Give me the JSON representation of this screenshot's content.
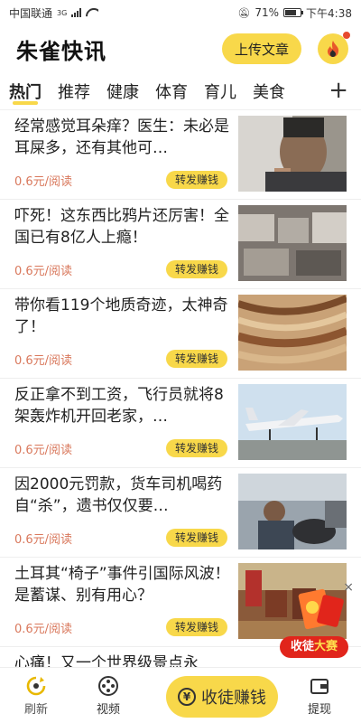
{
  "status_bar": {
    "carrier": "中国联通",
    "network": "3G",
    "battery": "71%",
    "time": "下午4:38"
  },
  "header": {
    "title": "朱雀快讯",
    "upload_label": "上传文章",
    "fire_icon": "fire-icon"
  },
  "tabs": [
    "热门",
    "推荐",
    "健康",
    "体育",
    "育儿",
    "美食"
  ],
  "tab_add": "+",
  "feed": [
    {
      "title": "经常感觉耳朵痒？医生：未必是耳屎多，还有其他可…",
      "price": "0.6元/阅读",
      "share": "转发赚钱"
    },
    {
      "title": "吓死！这东西比鸦片还厉害！全国已有8亿人上瘾！",
      "price": "0.6元/阅读",
      "share": "转发赚钱"
    },
    {
      "title": "带你看119个地质奇迹，太神奇了！",
      "price": "0.6元/阅读",
      "share": "转发赚钱"
    },
    {
      "title": "反正拿不到工资，飞行员就将8架轰炸机开回老家，…",
      "price": "0.6元/阅读",
      "share": "转发赚钱"
    },
    {
      "title": "因2000元罚款，货车司机喝药自“杀”，遗书仅仅要…",
      "price": "0.6元/阅读",
      "share": "转发赚钱"
    },
    {
      "title": "土耳其“椅子”事件引国际风波！是蓄谋、别有用心？",
      "price": "0.6元/阅读",
      "share": "转发赚钱"
    },
    {
      "title": "心痛！又一个世界级景点永",
      "price": "",
      "share": ""
    }
  ],
  "floating_banner": {
    "text_a": "收徒",
    "text_b": "大赛",
    "close": "×"
  },
  "bottom_nav": {
    "refresh": "刷新",
    "video": "视频",
    "center": "收徒赚钱",
    "center_symbol": "¥",
    "withdraw": "提现"
  }
}
